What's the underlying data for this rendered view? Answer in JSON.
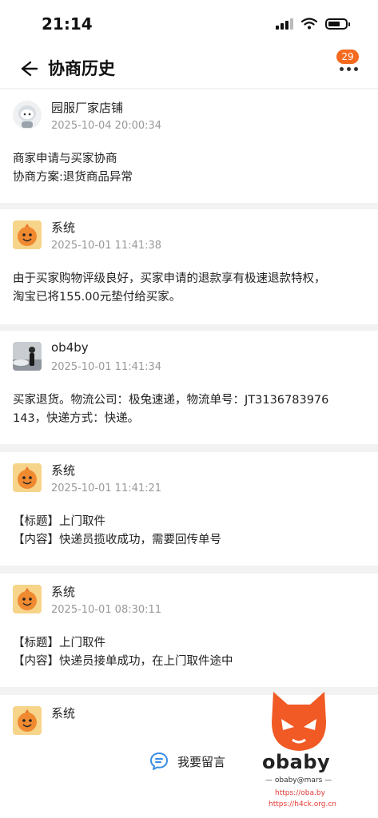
{
  "status_bar": {
    "time": "21:14"
  },
  "nav": {
    "title": "协商历史",
    "badge": "29"
  },
  "messages": [
    {
      "name": "园服厂家店铺",
      "timestamp": "2025-10-04 20:00:34",
      "lines": [
        "商家申请与买家协商",
        "协商方案:退货商品异常"
      ]
    },
    {
      "name": "系统",
      "timestamp": "2025-10-01 11:41:38",
      "lines": [
        "由于买家购物评级良好，买家申请的退款享有极速退款特权，",
        "淘宝已将155.00元垫付给买家。"
      ]
    },
    {
      "name": "ob4by",
      "timestamp": "2025-10-01 11:41:34",
      "lines": [
        "买家退货。物流公司：极兔速递，物流单号：JT3136783976",
        "143，快递方式：快递。"
      ]
    },
    {
      "name": "系统",
      "timestamp": "2025-10-01 11:41:21",
      "lines": [
        "【标题】上门取件",
        "【内容】快递员揽收成功，需要回传单号"
      ]
    },
    {
      "name": "系统",
      "timestamp": "2025-10-01 08:30:11",
      "lines": [
        "【标题】上门取件",
        "【内容】快递员接单成功，在上门取件途中"
      ]
    },
    {
      "name": "系统"
    }
  ],
  "footer": {
    "leave_message": "我要留言"
  },
  "watermark": {
    "brand": "obaby",
    "tag": "— obaby@mars —",
    "url1": "https://oba.by",
    "url2": "https://h4ck.org.cn"
  }
}
